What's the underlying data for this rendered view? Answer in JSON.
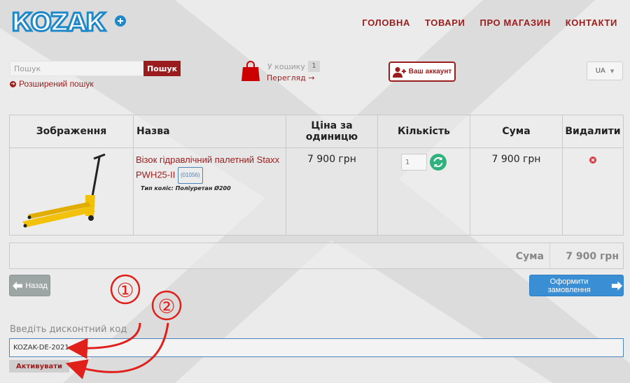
{
  "header": {
    "logo_text": "КОZАК",
    "nav": [
      "ГОЛОВНА",
      "ТОВАРИ",
      "ПРО МАГАЗИН",
      "КОНТАКТИ"
    ]
  },
  "search": {
    "placeholder": "Пошук",
    "button_label": "Пошук",
    "advanced_label": "Розширений пошук"
  },
  "cart": {
    "label": "У кошику",
    "count": "1",
    "view_label": "Перегляд →"
  },
  "account": {
    "label": "Ваш аккаунт"
  },
  "language": {
    "selected": "UA"
  },
  "table": {
    "headers": [
      "Зображення",
      "Назва",
      "Ціна за одиницю",
      "Кількість",
      "Сума",
      "Видалити"
    ],
    "rows": [
      {
        "name": "Візок гідравлічний палетний Staxx PWH25-II",
        "sku": "(01056)",
        "option": "Тип коліс: Поліуретан Ø200",
        "unit_price": "7 900 грн",
        "quantity": "1",
        "sum": "7 900 грн"
      }
    ]
  },
  "totals": {
    "label": "Сума",
    "value": "7 900 грн"
  },
  "buttons": {
    "back": "Назад",
    "checkout": "Оформити замовлення"
  },
  "discount": {
    "label": "Введіть дисконтний код",
    "value": "KOZAK-DE-2021",
    "activate": "Активувати"
  },
  "annotations": [
    "①",
    "②"
  ],
  "colors": {
    "brand_red": "#9b1c1c",
    "checkout_blue": "#3a8ed4",
    "logo_blue": "#1e88c8",
    "annotation_red": "#e0201b",
    "refresh_green": "#2fb27d"
  },
  "icons": [
    "shopping-bag-icon",
    "user-plus-icon",
    "arrow-circle-icon",
    "refresh-icon",
    "delete-icon",
    "arrow-left-icon",
    "arrow-right-icon",
    "chevron-down-icon"
  ]
}
